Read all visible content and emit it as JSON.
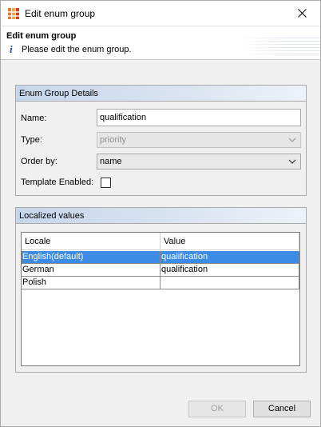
{
  "window": {
    "title": "Edit enum group",
    "close_icon": "close-icon"
  },
  "banner": {
    "title": "Edit enum group",
    "message": "Please edit the enum group.",
    "info_icon": "info-icon"
  },
  "details": {
    "header": "Enum Group Details",
    "name_label": "Name:",
    "name_value": "qualification",
    "type_label": "Type:",
    "type_value": "priority",
    "order_label": "Order by:",
    "order_value": "name",
    "template_label": "Template Enabled:",
    "template_checked": false
  },
  "localized": {
    "header": "Localized values",
    "columns": [
      "Locale",
      "Value"
    ],
    "rows": [
      {
        "locale": "English(default)",
        "value": "qualification",
        "selected": true
      },
      {
        "locale": "German",
        "value": "qualification",
        "selected": false
      },
      {
        "locale": "Polish",
        "value": "",
        "selected": false
      }
    ]
  },
  "buttons": {
    "ok": "OK",
    "cancel": "Cancel"
  },
  "colors": {
    "selection": "#3c8ce6",
    "group_header": "#c6d6ea"
  }
}
